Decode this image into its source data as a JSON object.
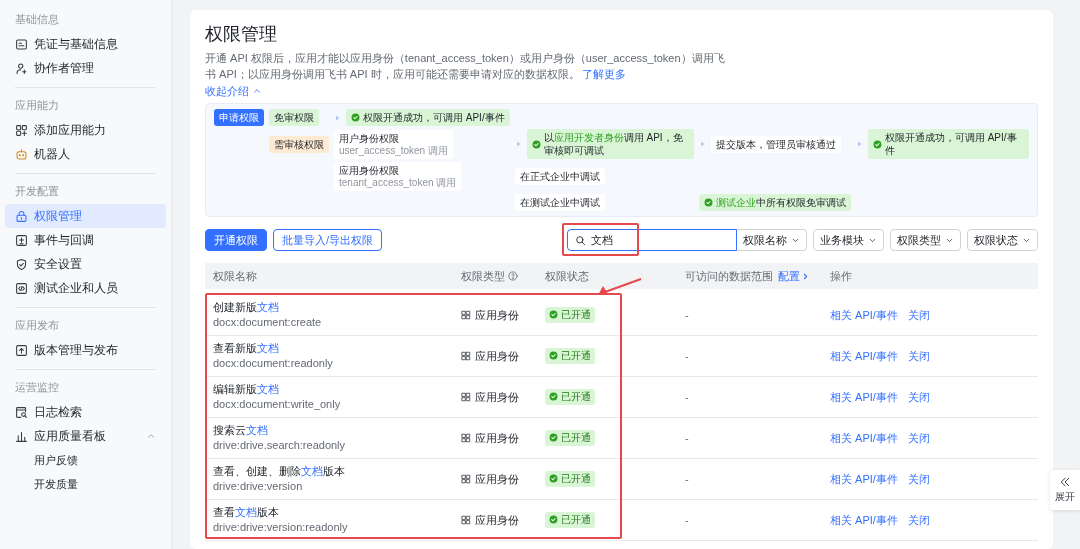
{
  "sidebar": {
    "sections": [
      {
        "heading": "基础信息",
        "items": [
          {
            "label": "凭证与基础信息",
            "selected": false
          },
          {
            "label": "协作者管理",
            "selected": false
          }
        ]
      },
      {
        "heading": "应用能力",
        "items": [
          {
            "label": "添加应用能力",
            "selected": false
          },
          {
            "label": "机器人",
            "selected": false
          }
        ]
      },
      {
        "heading": "开发配置",
        "items": [
          {
            "label": "权限管理",
            "selected": true
          },
          {
            "label": "事件与回调",
            "selected": false
          },
          {
            "label": "安全设置",
            "selected": false
          },
          {
            "label": "测试企业和人员",
            "selected": false
          }
        ]
      },
      {
        "heading": "应用发布",
        "items": [
          {
            "label": "版本管理与发布",
            "selected": false
          }
        ]
      },
      {
        "heading": "运营监控",
        "items": [
          {
            "label": "日志检索",
            "selected": false
          },
          {
            "label": "应用质量看板",
            "selected": false,
            "expanded": true,
            "children": [
              {
                "label": "用户反馈",
                "selected": false
              },
              {
                "label": "开发质量",
                "selected": false
              }
            ]
          }
        ]
      }
    ]
  },
  "page": {
    "title": "权限管理",
    "description": "开通 API 权限后，应用才能以应用身份（tenant_access_token）或用户身份（user_access_token）调用飞书 API；以应用身份调用飞书 API 时，应用可能还需要申请对应的数据权限。",
    "learn_more": "了解更多",
    "intro_toggle": "收起介绍",
    "intro_expanded": true
  },
  "diagram": {
    "rows": [
      [
        {
          "kind": "primary",
          "text": "申请权限",
          "arrow": false
        },
        {
          "kind": "free",
          "text": "免审权限",
          "arrow": false
        },
        {
          "kind": "success",
          "arrow": true,
          "parts": [
            {
              "text": "权限开通成功，可调用 API/事件",
              "match": false
            }
          ]
        },
        null,
        null,
        null
      ],
      [
        null,
        {
          "kind": "review",
          "text": "需审核权限",
          "arrow": false
        },
        {
          "kind": "role",
          "text": "用户身份权限",
          "note": "user_access_token 调用",
          "arrow": false
        },
        {
          "kind": "success",
          "arrow": true,
          "parts": [
            {
              "text": "以",
              "match": false
            },
            {
              "text": "应用开发者身份",
              "match": true
            },
            {
              "text": "调用 API，免审核即可调试",
              "match": false
            }
          ]
        },
        {
          "kind": "step",
          "text": "提交版本，管理员审核通过",
          "arrow": true
        },
        {
          "kind": "success",
          "arrow": true,
          "parts": [
            {
              "text": "权限开通成功，可调用 API/事件",
              "match": false
            }
          ]
        }
      ],
      [
        null,
        null,
        {
          "kind": "role",
          "text": "应用身份权限",
          "note": "tenant_access_token 调用",
          "arrow": false
        },
        {
          "kind": "step",
          "text": "在正式企业中调试",
          "arrow": false
        },
        null,
        null
      ],
      [
        null,
        null,
        null,
        {
          "kind": "step",
          "text": "在测试企业中调试",
          "arrow": false
        },
        {
          "kind": "success",
          "arrow": false,
          "parts": [
            {
              "text": "测试企业",
              "match": true
            },
            {
              "text": "中所有权限免审调试",
              "match": false
            }
          ]
        },
        null
      ]
    ]
  },
  "toolbar": {
    "buttons": [
      {
        "label": "开通权限",
        "kind": "primary"
      },
      {
        "label": "批量导入/导出权限",
        "kind": "outline"
      }
    ],
    "search": {
      "value": "文档"
    },
    "filters": [
      "权限名称",
      "业务模块",
      "权限类型",
      "权限状态"
    ]
  },
  "table": {
    "columns": [
      {
        "label": "权限名称"
      },
      {
        "label": "权限类型",
        "help": true
      },
      {
        "label": "权限状态"
      },
      {
        "label": "可访问的数据范围",
        "link": "配置"
      },
      {
        "label": "操作"
      }
    ],
    "rows": [
      {
        "name": [
          {
            "text": "创建新版",
            "match": false
          },
          {
            "text": "文档",
            "match": true
          }
        ],
        "scope": "docx:document:create",
        "type": "应用身份",
        "status": "已开通",
        "data_range": "-",
        "actions": [
          "相关 API/事件",
          "关闭"
        ]
      },
      {
        "name": [
          {
            "text": "查看新版",
            "match": false
          },
          {
            "text": "文档",
            "match": true
          }
        ],
        "scope": "docx:document:readonly",
        "type": "应用身份",
        "status": "已开通",
        "data_range": "-",
        "actions": [
          "相关 API/事件",
          "关闭"
        ]
      },
      {
        "name": [
          {
            "text": "编辑新版",
            "match": false
          },
          {
            "text": "文档",
            "match": true
          }
        ],
        "scope": "docx:document:write_only",
        "type": "应用身份",
        "status": "已开通",
        "data_range": "-",
        "actions": [
          "相关 API/事件",
          "关闭"
        ]
      },
      {
        "name": [
          {
            "text": "搜索云",
            "match": false
          },
          {
            "text": "文档",
            "match": true
          }
        ],
        "scope": "drive:drive.search:readonly",
        "type": "应用身份",
        "status": "已开通",
        "data_range": "-",
        "actions": [
          "相关 API/事件",
          "关闭"
        ]
      },
      {
        "name": [
          {
            "text": "查看、创建、删除",
            "match": false
          },
          {
            "text": "文档",
            "match": true
          },
          {
            "text": "版本",
            "match": false
          }
        ],
        "scope": "drive:drive:version",
        "type": "应用身份",
        "status": "已开通",
        "data_range": "-",
        "actions": [
          "相关 API/事件",
          "关闭"
        ]
      },
      {
        "name": [
          {
            "text": "查看",
            "match": false
          },
          {
            "text": "文档",
            "match": true
          },
          {
            "text": "版本",
            "match": false
          }
        ],
        "scope": "drive:drive:version:readonly",
        "type": "应用身份",
        "status": "已开通",
        "data_range": "-",
        "actions": [
          "相关 API/事件",
          "关闭"
        ]
      }
    ]
  },
  "side_toggle": {
    "label": "展开"
  }
}
